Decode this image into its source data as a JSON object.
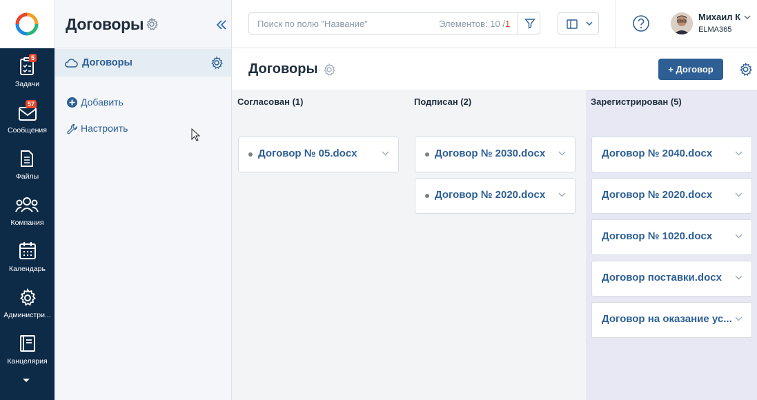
{
  "rail": {
    "items": [
      {
        "label": "Задачи",
        "badge": "5"
      },
      {
        "label": "Сообщения",
        "badge": "57"
      },
      {
        "label": "Файлы"
      },
      {
        "label": "Компания"
      },
      {
        "label": "Календарь"
      },
      {
        "label": "Администри..."
      },
      {
        "label": "Канцелярия"
      }
    ]
  },
  "sidebar": {
    "title": "Договоры",
    "active_item": "Договоры",
    "actions": [
      {
        "label": "Добавить"
      },
      {
        "label": "Настроить"
      }
    ]
  },
  "topbar": {
    "search_placeholder": "Поиск по полю \"Название\"",
    "count_label": "Элементов: 10 /",
    "count_page": "1",
    "user_name": "Михаил К",
    "user_org": "ELMA365"
  },
  "page": {
    "title": "Договоры",
    "add_button": "+ Договор"
  },
  "board": {
    "columns": [
      {
        "title": "Согласован (1)",
        "cards": [
          {
            "name": "Договор № 05.docx",
            "dot": true
          }
        ]
      },
      {
        "title": "Подписан (2)",
        "cards": [
          {
            "name": "Договор № 2030.docx",
            "dot": true
          },
          {
            "name": "Договор № 2020.docx",
            "dot": true
          }
        ]
      },
      {
        "title": "Зарегистрирован (5)",
        "cards": [
          {
            "name": "Договор № 2040.docx",
            "dot": false
          },
          {
            "name": "Договор № 2020.docx",
            "dot": false
          },
          {
            "name": "Договор № 1020.docx",
            "dot": false
          },
          {
            "name": "Договор поставки.docx",
            "dot": false
          },
          {
            "name": "Договор на оказание ус...",
            "dot": false
          }
        ]
      }
    ]
  },
  "colors": {
    "rail_bg": "#0d2a47",
    "accent": "#2d5f94",
    "badge": "#e8462b",
    "highlight_column": "#e7e8f4"
  }
}
